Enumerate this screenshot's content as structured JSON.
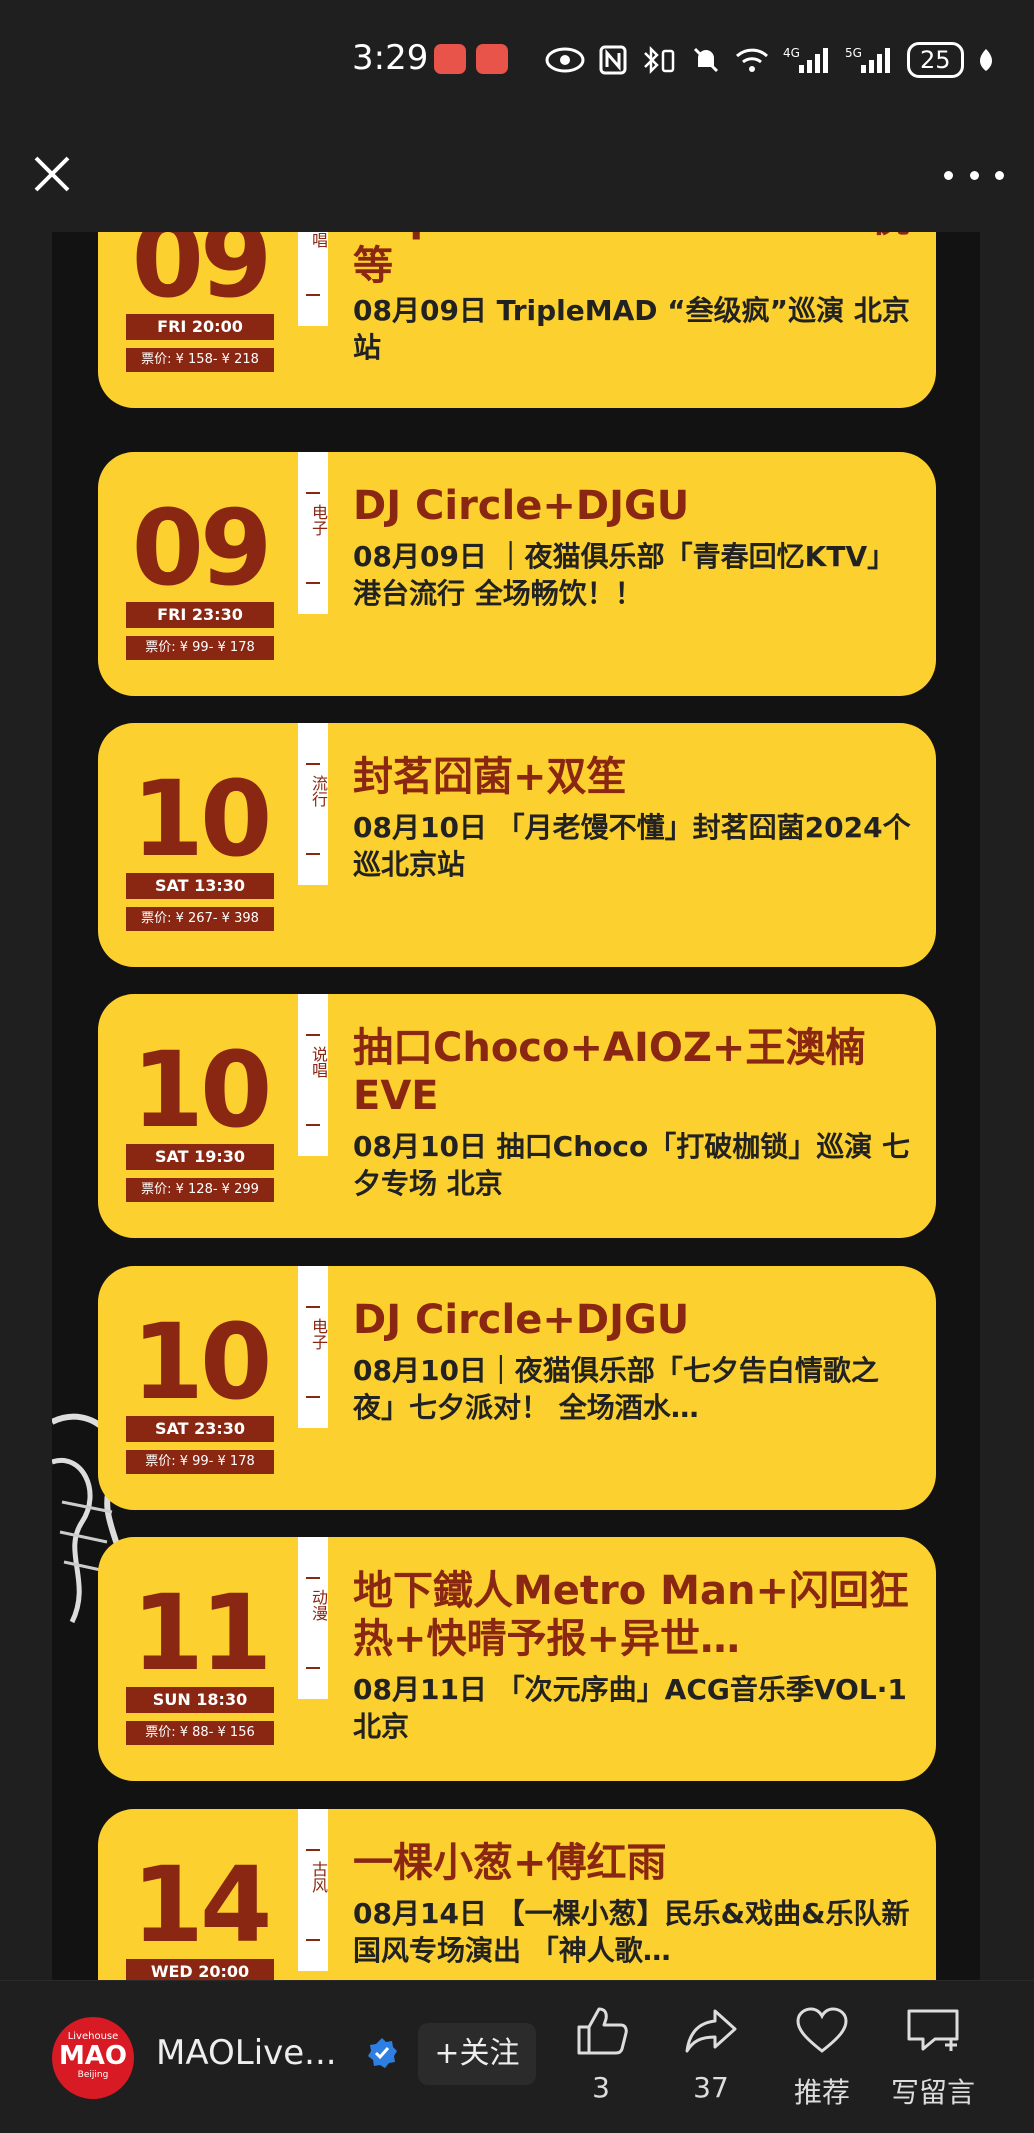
{
  "status_bar": {
    "time": "3:29",
    "network_left": "4G",
    "network_right": "5G",
    "battery": "25"
  },
  "events": [
    {
      "day": "09",
      "time": "FRI 20:00",
      "price": "票价: ¥ 158- ¥ 218",
      "genre": "说唱",
      "title": "TripleMAD+BeCareful+悦等",
      "desc": "08月09日 TripleMAD “叁级疯”巡演 北京站"
    },
    {
      "day": "09",
      "time": "FRI 23:30",
      "price": "票价: ¥ 99- ¥ 178",
      "genre": "电子",
      "title": "DJ Circle+DJGU",
      "desc": "08月09日 ｜夜猫俱乐部「青春回忆KTV」港台流行 全场畅饮！！"
    },
    {
      "day": "10",
      "time": "SAT 13:30",
      "price": "票价: ¥ 267- ¥ 398",
      "genre": "流行",
      "title": "封茗囧菌+双笙",
      "desc": "08月10日 「月老馒不懂」封茗囧菌2024个巡北京站"
    },
    {
      "day": "10",
      "time": "SAT 19:30",
      "price": "票价: ¥ 128- ¥ 299",
      "genre": "说唱",
      "title": "抽口Choco+AIOZ+王澳楠EVE",
      "desc": "08月10日 抽口Choco「打破枷锁」巡演 七夕专场 北京"
    },
    {
      "day": "10",
      "time": "SAT 23:30",
      "price": "票价: ¥ 99- ¥ 178",
      "genre": "电子",
      "title": "DJ Circle+DJGU",
      "desc": "08月10日｜夜猫俱乐部「七夕告白情歌之夜」七夕派对！ 全场酒水…"
    },
    {
      "day": "11",
      "time": "SUN 18:30",
      "price": "票价: ¥ 88- ¥ 156",
      "genre": "动漫",
      "title": "地下鐵人Metro Man+闪回狂热+快晴予报+异世…",
      "desc": "08月11日 「次元序曲」ACG音乐季VOL·1 北京"
    },
    {
      "day": "14",
      "time": "WED 20:00",
      "price": "",
      "genre": "古风",
      "title": "一棵小葱+傅红雨",
      "desc": "08月14日 【一棵小葱】民乐&戏曲&乐队新国风专场演出 「神人歌…"
    }
  ],
  "account": {
    "logo_top": "Livehouse",
    "logo_main": "MAO",
    "logo_sub": "Beijing",
    "name": "MAOLive...",
    "follow_label": "+关注"
  },
  "actions": [
    {
      "icon": "thumbs-up-icon",
      "label": "3"
    },
    {
      "icon": "share-icon",
      "label": "37"
    },
    {
      "icon": "heart-icon",
      "label": "推荐"
    },
    {
      "icon": "comment-icon",
      "label": "写留言"
    }
  ],
  "colors": {
    "card": "#fcd02e",
    "brand_red": "#8a2712",
    "background": "#1f1f1f"
  }
}
